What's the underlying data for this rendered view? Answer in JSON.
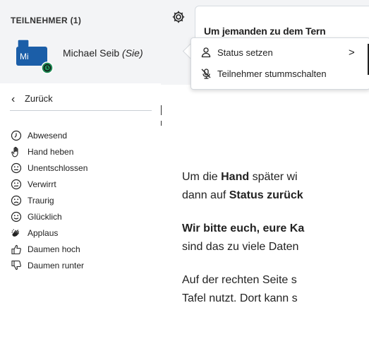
{
  "participants": {
    "title": "TEILNEHMER (1)",
    "user_name": "Michael Seib",
    "user_tag": "(Sie)",
    "avatar_initials": "Mi"
  },
  "card": {
    "title_partial": "Um jemanden zu dem Tern"
  },
  "popup": {
    "status_label": "Status setzen",
    "mute_label": "Teilnehmer stummschalten",
    "chevron": ">"
  },
  "status_menu": {
    "back_label": "Zurück",
    "items": [
      {
        "label": "Abwesend",
        "icon": "clock-icon"
      },
      {
        "label": "Hand heben",
        "icon": "hand-icon"
      },
      {
        "label": "Unentschlossen",
        "icon": "neutral-face-icon"
      },
      {
        "label": "Verwirrt",
        "icon": "confused-face-icon"
      },
      {
        "label": "Traurig",
        "icon": "sad-face-icon"
      },
      {
        "label": "Glücklich",
        "icon": "happy-face-icon"
      },
      {
        "label": "Applaus",
        "icon": "clapping-icon"
      },
      {
        "label": "Daumen hoch",
        "icon": "thumbs-up-icon"
      },
      {
        "label": "Daumen runter",
        "icon": "thumbs-down-icon"
      }
    ]
  },
  "content": {
    "p1_line1_a": "Um die ",
    "p1_line1_b": "Hand",
    "p1_line1_c": " später wi",
    "p1_line2_a": "dann auf ",
    "p1_line2_b": "Status zurück",
    "p2_line1": "Wir bitte euch, eure Ka",
    "p2_line2": "sind das zu viele Daten",
    "p3_line1": "Auf der rechten Seite s",
    "p3_line2": "Tafel nutzt. Dort kann s"
  },
  "colors": {
    "accent": "#1b5ea8",
    "status_green": "#1f8a55",
    "panel_bg": "#f3f4f6"
  }
}
